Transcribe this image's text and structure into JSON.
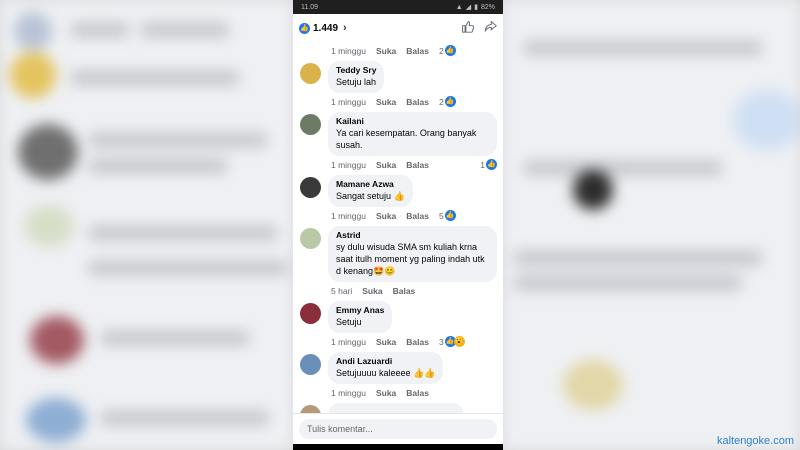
{
  "status_bar": {
    "time": "11.09",
    "battery": "82%"
  },
  "post": {
    "reaction_count": "1.449"
  },
  "thread": {
    "first_meta": {
      "time": "1 minggu",
      "like": "Suka",
      "reply": "Balas",
      "reactions": "2"
    },
    "comments": [
      {
        "name": "Teddy Sry",
        "text": "Setuju lah",
        "time": "1 minggu",
        "like": "Suka",
        "reply": "Balas",
        "reactions": "2",
        "avatar_color": "#d9b24a"
      },
      {
        "name": "Kailani",
        "text": "Ya cari kesempatan. Orang banyak susah.",
        "time": "1 minggu",
        "like": "Suka",
        "reply": "Balas",
        "reactions": "1",
        "avatar_color": "#6d7a66"
      },
      {
        "name": "Mamane Azwa",
        "text": "Sangat setuju 👍",
        "time": "1 minggu",
        "like": "Suka",
        "reply": "Balas",
        "reactions": "5",
        "avatar_color": "#3a3a3a"
      },
      {
        "name": "Astrid",
        "text": "sy dulu wisuda SMA sm kuliah  krna saat itulh moment yg paling indah utk d kenang🤩😊",
        "time": "5 hari",
        "like": "Suka",
        "reply": "Balas",
        "reactions": "",
        "avatar_color": "#b9c9a6"
      },
      {
        "name": "Emmy Anas",
        "text": "Setuju",
        "time": "1 minggu",
        "like": "Suka",
        "reply": "Balas",
        "reactions": "3",
        "avatar_color": "#8a2e3c"
      },
      {
        "name": "Andi Lazuardi",
        "text": "Setujuuuu kaleeee 👍👍",
        "time": "1 minggu",
        "like": "Suka",
        "reply": "Balas",
        "reactions": "",
        "avatar_color": "#6a8fb8"
      }
    ]
  },
  "composer": {
    "placeholder": "Tulis komentar..."
  },
  "watermark": "kaltengoke.com",
  "colors": {
    "facebook_blue": "#1877f2",
    "bubble": "#f0f2f5"
  }
}
